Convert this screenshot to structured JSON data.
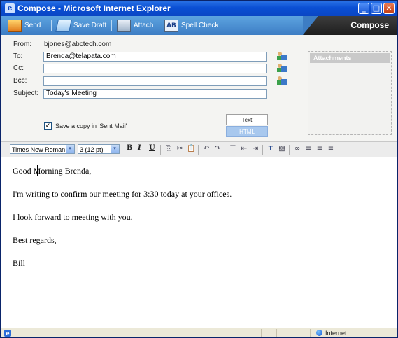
{
  "window": {
    "title": "Compose - Microsoft Internet Explorer",
    "ie_icon": "e",
    "controls": {
      "minimize": "_",
      "maximize": "□",
      "close": "✕"
    }
  },
  "toolbar": {
    "send_label": "Send",
    "save_draft_label": "Save Draft",
    "attach_label": "Attach",
    "spell_check_label": "Spell Check",
    "spell_icon_glyph": "AB",
    "section_title": "Compose"
  },
  "header": {
    "from_label": "From:",
    "from_value": "bjones@abctech.com",
    "to_label": "To:",
    "to_value": "Brenda@telapata.com",
    "cc_label": "Cc:",
    "cc_value": "",
    "bcc_label": "Bcc:",
    "bcc_value": "",
    "subject_label": "Subject:",
    "subject_value": "Today's Meeting",
    "save_copy_label": "Save a copy in 'Sent Mail'",
    "save_copy_checked_glyph": "✓",
    "text_tab": "Text",
    "html_tab": "HTML",
    "attachments_title": "Attachments"
  },
  "format_bar": {
    "font_value": "Times New Roman",
    "size_value": "3 (12 pt)",
    "dropdown_glyph": "▾",
    "bold": "B",
    "italic": "I",
    "underline": "U",
    "icons": [
      "copy-icon",
      "cut-icon",
      "paste-icon",
      "undo-icon",
      "redo-icon",
      "numbered-list-icon",
      "outdent-icon",
      "indent-icon",
      "text-color-icon",
      "highlight-icon",
      "link-icon",
      "align-left-icon",
      "align-center-icon",
      "align-right-icon"
    ],
    "glyphs": {
      "copy": "⎘",
      "cut": "✂",
      "paste": "📋",
      "undo": "↶",
      "redo": "↷",
      "numbered_list": "☰",
      "outdent": "⇤",
      "indent": "⇥",
      "text_color": "T",
      "highlight": "▨",
      "link": "∞",
      "align_left": "≡",
      "align_center": "≡",
      "align_right": "≡"
    }
  },
  "body": {
    "lines": [
      "Good Morning Brenda,",
      "I'm writing to confirm our meeting for 3:30 today at your offices.",
      "I look forward to meeting with you.",
      "Best regards,",
      "Bill"
    ]
  },
  "statusbar": {
    "ie_icon": "e",
    "zone": "Internet"
  },
  "colors": {
    "titlebar": "#0a4fd4",
    "toolbar": "#3d7dc4",
    "compose_tab": "#1e1e1e",
    "html_tab": "#a8c8ee"
  }
}
